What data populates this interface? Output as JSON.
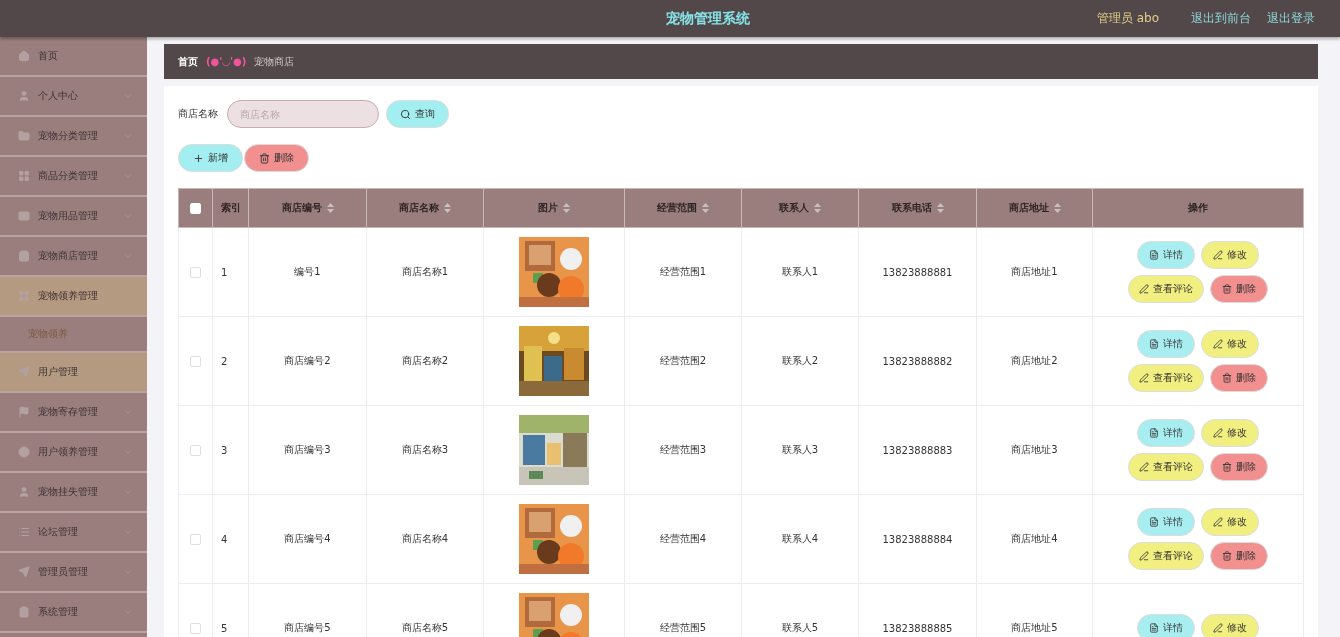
{
  "header": {
    "title": "宠物管理系统",
    "user": "管理员 abo",
    "links": [
      "退出到前台",
      "退出登录"
    ]
  },
  "sidebar": {
    "items": [
      {
        "label": "首页",
        "highlighted": false,
        "expanded": false
      },
      {
        "label": "个人中心",
        "highlighted": false,
        "expanded": false
      },
      {
        "label": "宠物分类管理",
        "highlighted": false,
        "expanded": false
      },
      {
        "label": "商品分类管理",
        "highlighted": false,
        "expanded": false
      },
      {
        "label": "宠物用品管理",
        "highlighted": false,
        "expanded": false
      },
      {
        "label": "宠物商店管理",
        "highlighted": false,
        "expanded": false
      },
      {
        "label": "宠物领养管理",
        "highlighted": true,
        "expanded": true,
        "children": [
          {
            "label": "宠物领养"
          }
        ]
      },
      {
        "label": "用户管理",
        "highlighted": true,
        "expanded": false
      },
      {
        "label": "宠物寄存管理",
        "highlighted": false,
        "expanded": false
      },
      {
        "label": "用户领养管理",
        "highlighted": false,
        "expanded": false
      },
      {
        "label": "宠物挂失管理",
        "highlighted": false,
        "expanded": false
      },
      {
        "label": "论坛管理",
        "highlighted": false,
        "expanded": false
      },
      {
        "label": "管理员管理",
        "highlighted": false,
        "expanded": false
      },
      {
        "label": "系统管理",
        "highlighted": false,
        "expanded": false
      }
    ]
  },
  "breadcrumb": {
    "home": "首页",
    "emoticon": "(●'◡'●)",
    "current": "宠物商店"
  },
  "search": {
    "label": "商店名称",
    "placeholder": "商店名称",
    "button": {
      "kind": "search",
      "label": "查询"
    }
  },
  "toolbar": [
    {
      "kind": "add",
      "label": "新增"
    },
    {
      "kind": "delete",
      "label": "删除"
    }
  ],
  "table": {
    "select_all_checked": false,
    "columns": [
      {
        "label": "索引",
        "sortable": false
      },
      {
        "label": "商店编号",
        "sortable": true
      },
      {
        "label": "商店名称",
        "sortable": true
      },
      {
        "label": "图片",
        "sortable": true
      },
      {
        "label": "经营范围",
        "sortable": true
      },
      {
        "label": "联系人",
        "sortable": true
      },
      {
        "label": "联系电话",
        "sortable": true
      },
      {
        "label": "商店地址",
        "sortable": true
      },
      {
        "label": "操作",
        "sortable": false
      }
    ],
    "rows": [
      {
        "checked": false,
        "cells": [
          "1",
          "编号1",
          "商店名称1",
          {
            "kind": "picture"
          },
          "经营范围1",
          "联系人1",
          "13823888881",
          "商店地址1"
        ],
        "actions": [
          {
            "kind": "detail",
            "label": "详情"
          },
          {
            "kind": "edit",
            "label": "修改"
          },
          {
            "kind": "edit",
            "label": "查看评论"
          },
          {
            "kind": "delete",
            "label": "删除"
          }
        ]
      },
      {
        "checked": false,
        "cells": [
          "2",
          "商店编号2",
          "商店名称2",
          {
            "kind": "picture"
          },
          "经营范围2",
          "联系人2",
          "13823888882",
          "商店地址2"
        ],
        "actions": [
          {
            "kind": "detail",
            "label": "详情"
          },
          {
            "kind": "edit",
            "label": "修改"
          },
          {
            "kind": "edit",
            "label": "查看评论"
          },
          {
            "kind": "delete",
            "label": "删除"
          }
        ]
      },
      {
        "checked": false,
        "cells": [
          "3",
          "商店编号3",
          "商店名称3",
          {
            "kind": "picture"
          },
          "经营范围3",
          "联系人3",
          "13823888883",
          "商店地址3"
        ],
        "actions": [
          {
            "kind": "detail",
            "label": "详情"
          },
          {
            "kind": "edit",
            "label": "修改"
          },
          {
            "kind": "edit",
            "label": "查看评论"
          },
          {
            "kind": "delete",
            "label": "删除"
          }
        ]
      },
      {
        "checked": false,
        "cells": [
          "4",
          "商店编号4",
          "商店名称4",
          {
            "kind": "picture"
          },
          "经营范围4",
          "联系人4",
          "13823888884",
          "商店地址4"
        ],
        "actions": [
          {
            "kind": "detail",
            "label": "详情"
          },
          {
            "kind": "edit",
            "label": "修改"
          },
          {
            "kind": "edit",
            "label": "查看评论"
          },
          {
            "kind": "delete",
            "label": "删除"
          }
        ]
      },
      {
        "checked": false,
        "cells": [
          "5",
          "商店编号5",
          "商店名称5",
          {
            "kind": "picture"
          },
          "经营范围5",
          "联系人5",
          "13823888885",
          "商店地址5"
        ],
        "actions": [
          {
            "kind": "detail",
            "label": "详情"
          },
          {
            "kind": "edit",
            "label": "修改"
          }
        ]
      }
    ]
  }
}
